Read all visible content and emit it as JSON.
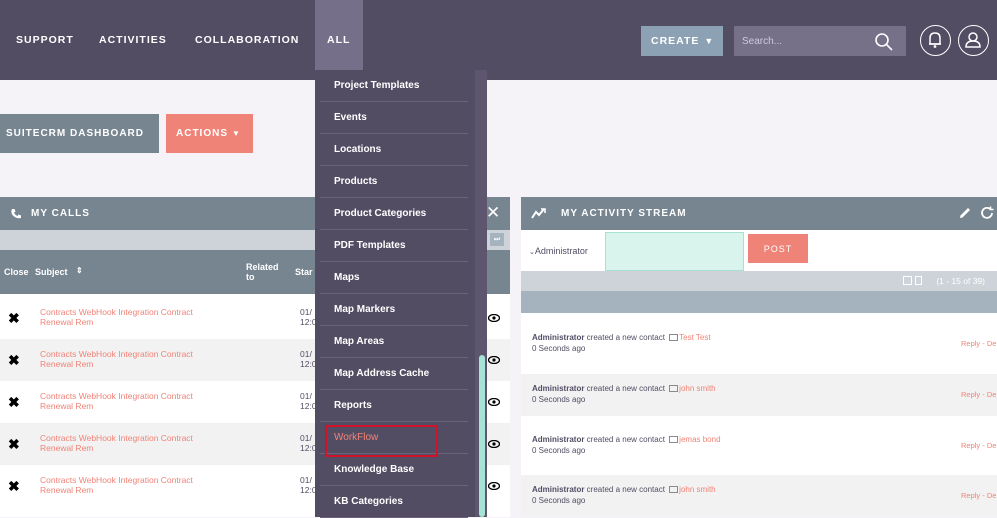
{
  "nav": {
    "items": [
      "SUPPORT",
      "ACTIVITIES",
      "COLLABORATION",
      "ALL"
    ],
    "create_label": "CREATE",
    "search_placeholder": "Search..."
  },
  "dashboard": {
    "tab_label": "SUITECRM DASHBOARD",
    "actions_label": "ACTIONS"
  },
  "calls": {
    "title": "MY CALLS",
    "columns": {
      "close": "Close",
      "subject": "Subject",
      "related": "Related to",
      "start": "Star"
    },
    "rows": [
      {
        "subject_line1": "Contracts WebHook Integration Contract",
        "subject_line2": "Renewal Rem",
        "date_line1": "01/",
        "date_line2": "12:0"
      },
      {
        "subject_line1": "Contracts WebHook Integration Contract",
        "subject_line2": "Renewal Rem",
        "date_line1": "01/",
        "date_line2": "12:0"
      },
      {
        "subject_line1": "Contracts WebHook Integration Contract",
        "subject_line2": "Renewal Rem",
        "date_line1": "01/",
        "date_line2": "12:0"
      },
      {
        "subject_line1": "Contracts WebHook Integration Contract",
        "subject_line2": "Renewal Rem",
        "date_line1": "01/",
        "date_line2": "12:0"
      },
      {
        "subject_line1": "Contracts WebHook Integration Contract",
        "subject_line2": "Renewal Rem",
        "date_line1": "01/",
        "date_line2": "12:0"
      }
    ]
  },
  "stream": {
    "title": "MY ACTIVITY STREAM",
    "user": "Administrator",
    "post_label": "POST",
    "pager": "(1 - 15 of 39)",
    "activities": [
      {
        "actor": "Administrator",
        "text": " created a new contact ",
        "contact": "Test Test",
        "time": "0 Seconds ago",
        "reply": "Reply - De"
      },
      {
        "actor": "Administrator",
        "text": " created a new contact ",
        "contact": "john smith",
        "time": "0 Seconds ago",
        "reply": "Reply - De"
      },
      {
        "actor": "Administrator",
        "text": " created a new contact ",
        "contact": "jemas bond",
        "time": "0 Seconds ago",
        "reply": "Reply - De"
      },
      {
        "actor": "Administrator",
        "text": " created a new contact ",
        "contact": "john smith",
        "time": "0 Seconds ago",
        "reply": "Reply - De"
      }
    ]
  },
  "menu": {
    "items": [
      "Project Templates",
      "Events",
      "Locations",
      "Products",
      "Product Categories",
      "PDF Templates",
      "Maps",
      "Map Markers",
      "Map Areas",
      "Map Address Cache",
      "Reports",
      "WorkFlow",
      "Knowledge Base",
      "KB Categories"
    ]
  },
  "colors": {
    "primary": "#534d64",
    "accent": "#f08377",
    "dashlet": "#778591",
    "highlight": "#d0122a"
  }
}
